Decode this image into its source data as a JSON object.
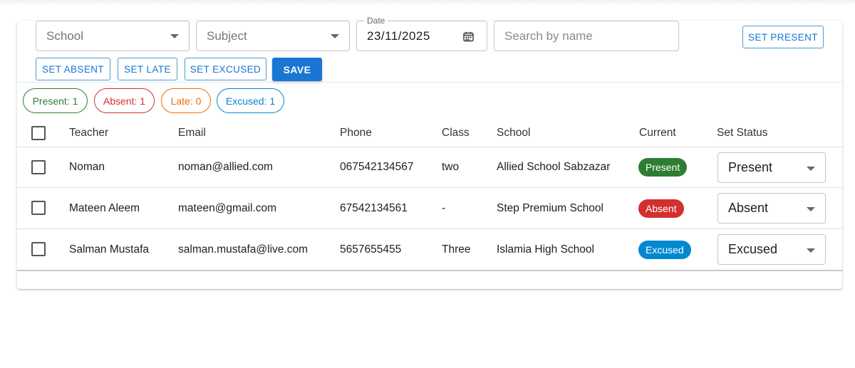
{
  "filters": {
    "school_placeholder": "School",
    "subject_placeholder": "Subject",
    "date_label": "Date",
    "date_value": "23/11/2025",
    "search_placeholder": "Search by name"
  },
  "actions": {
    "set_present": "SET PRESENT",
    "set_absent": "SET ABSENT",
    "set_late": "SET LATE",
    "set_excused": "SET EXCUSED",
    "save": "SAVE"
  },
  "summary": {
    "present": "Present: 1",
    "absent": "Absent: 1",
    "late": "Late: 0",
    "excused": "Excused: 1"
  },
  "table": {
    "headers": [
      "Teacher",
      "Email",
      "Phone",
      "Class",
      "School",
      "Current",
      "Set Status"
    ],
    "rows": [
      {
        "teacher": "Noman",
        "email": "noman@allied.com",
        "phone": "067542134567",
        "class": "two",
        "school": "Allied School Sabzazar",
        "current": "Present",
        "status": "Present"
      },
      {
        "teacher": "Mateen Aleem",
        "email": "mateen@gmail.com",
        "phone": "67542134561",
        "class": "-",
        "school": "Step Premium School",
        "current": "Absent",
        "status": "Absent"
      },
      {
        "teacher": "Salman Mustafa",
        "email": "salman.mustafa@live.com",
        "phone": "5657655455",
        "class": "Three",
        "school": "Islamia High School",
        "current": "Excused",
        "status": "Excused"
      }
    ]
  },
  "colors": {
    "primary": "#1976d2",
    "present": "#2e7d32",
    "absent": "#d32f2f",
    "late": "#ed6c02",
    "excused": "#0288d1"
  },
  "icons": {
    "calendar": "calendar-icon",
    "dropdown": "chevron-down-icon"
  }
}
